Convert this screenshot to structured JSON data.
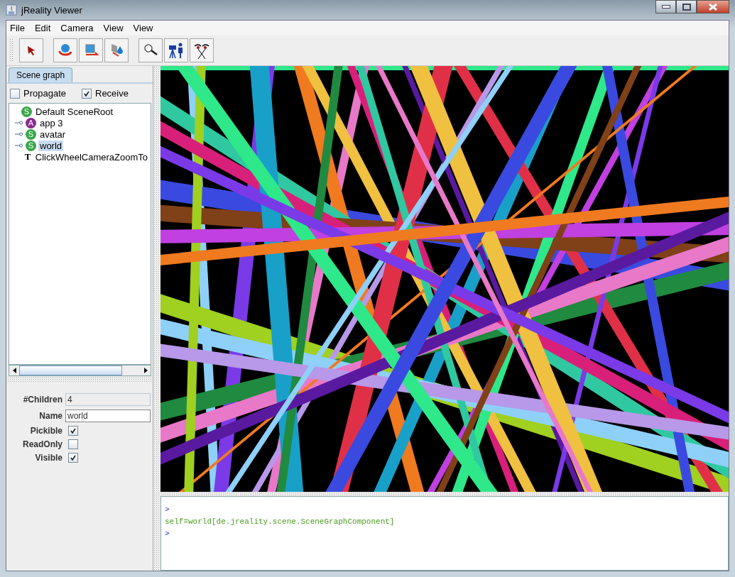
{
  "window": {
    "title": "jReality Viewer"
  },
  "menu": [
    "File",
    "Edit",
    "Camera",
    "View",
    "View"
  ],
  "toolbar": [
    {
      "kind": "pointer"
    },
    {
      "kind": "rotate"
    },
    {
      "kind": "translate"
    },
    {
      "kind": "drag"
    },
    {
      "kind": "zoom"
    },
    {
      "kind": "camera"
    },
    {
      "kind": "eyes"
    }
  ],
  "tabs": [
    {
      "label": "Scene graph",
      "selected": true
    }
  ],
  "options": [
    {
      "label": "Propagate",
      "checked": false
    },
    {
      "label": "Receive",
      "checked": true
    }
  ],
  "tree": [
    {
      "badge": "S",
      "kind": "scene",
      "label": "Default SceneRoot",
      "selected": false,
      "children": [
        {
          "badge": "A",
          "kind": "appearance",
          "label": "app 3",
          "selected": false,
          "expanded": false
        },
        {
          "badge": "S",
          "kind": "scene",
          "label": "avatar",
          "selected": false,
          "expanded": false
        },
        {
          "badge": "S",
          "kind": "scene",
          "label": "world",
          "selected": true,
          "expanded": false
        },
        {
          "badge": "T",
          "kind": "tool",
          "label": "ClickWheelCameraZoomTo",
          "selected": false
        }
      ]
    }
  ],
  "properties": [
    {
      "kind": "readonly",
      "label": "#Children",
      "value": "4"
    },
    {
      "kind": "text",
      "label": "Name",
      "value": "world"
    },
    {
      "kind": "check",
      "label": "Pickible",
      "checked": true
    },
    {
      "kind": "check",
      "label": "ReadOnly",
      "checked": false
    },
    {
      "kind": "check",
      "label": "Visible",
      "checked": true
    }
  ],
  "console": [
    {
      "kind": "prompt",
      "text": ">"
    },
    {
      "kind": "output",
      "text": "self=world[de.jreality.scene.SceneGraphComponent]"
    },
    {
      "kind": "prompt",
      "text": ">"
    }
  ]
}
